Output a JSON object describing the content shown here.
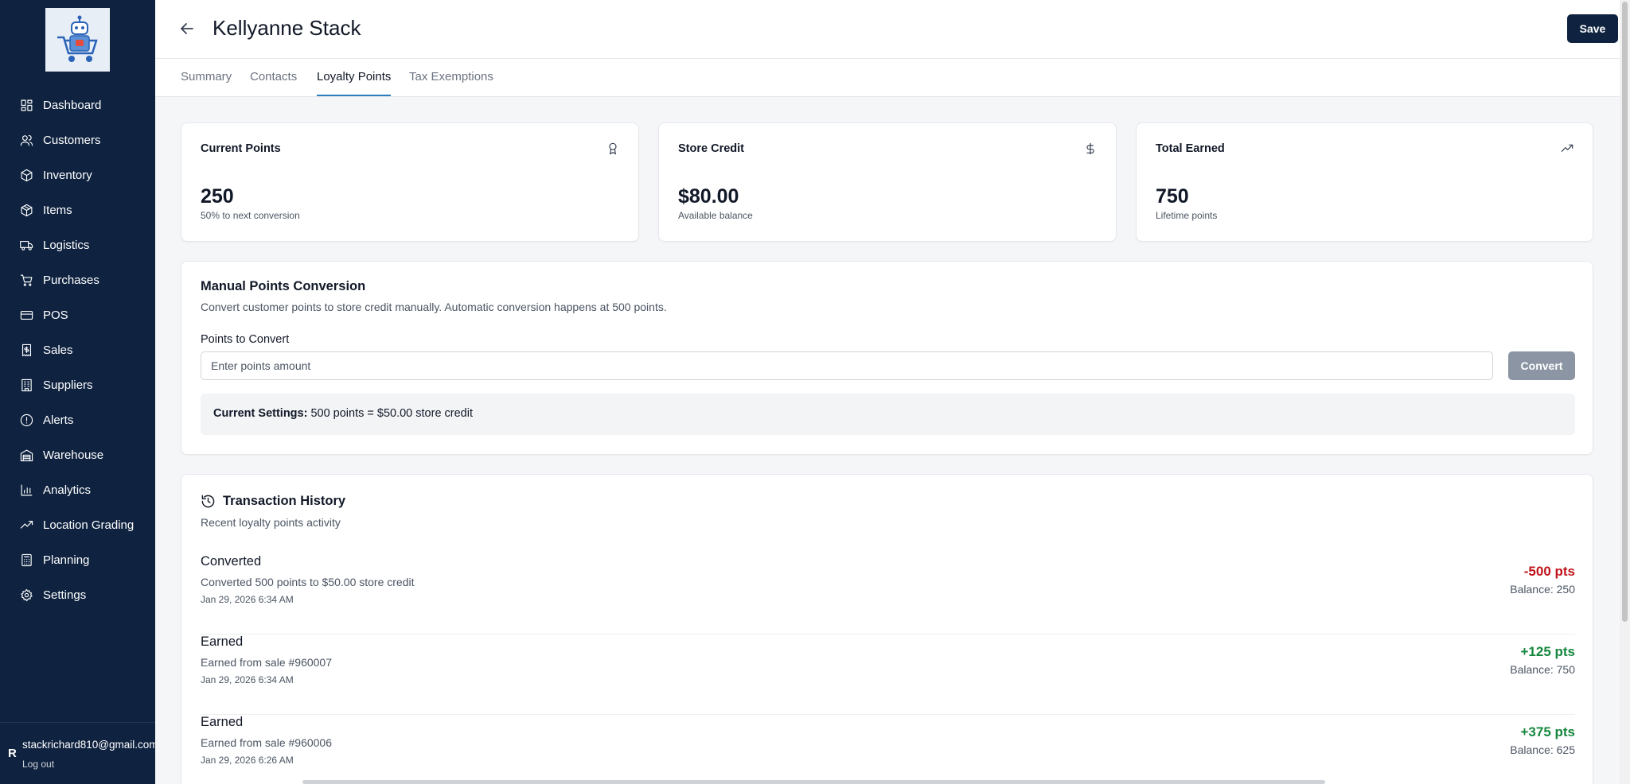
{
  "sidebar": {
    "items": [
      {
        "label": "Dashboard",
        "icon": "dashboard-icon"
      },
      {
        "label": "Customers",
        "icon": "users-icon"
      },
      {
        "label": "Inventory",
        "icon": "package-icon"
      },
      {
        "label": "Items",
        "icon": "box-icon"
      },
      {
        "label": "Logistics",
        "icon": "truck-icon"
      },
      {
        "label": "Purchases",
        "icon": "cart-icon"
      },
      {
        "label": "POS",
        "icon": "credit-card-icon"
      },
      {
        "label": "Sales",
        "icon": "receipt-icon"
      },
      {
        "label": "Suppliers",
        "icon": "building-icon"
      },
      {
        "label": "Alerts",
        "icon": "alert-circle-icon"
      },
      {
        "label": "Warehouse",
        "icon": "warehouse-icon"
      },
      {
        "label": "Analytics",
        "icon": "bar-chart-icon"
      },
      {
        "label": "Location Grading",
        "icon": "trending-up-icon"
      },
      {
        "label": "Planning",
        "icon": "calculator-icon"
      },
      {
        "label": "Settings",
        "icon": "gear-icon"
      }
    ],
    "user_initial": "R",
    "user_email": "stackrichard810@gmail.com",
    "logout_label": "Log out"
  },
  "header": {
    "title": "Kellyanne Stack",
    "save_label": "Save"
  },
  "tabs": [
    {
      "label": "Summary",
      "active": false
    },
    {
      "label": "Contacts",
      "active": false
    },
    {
      "label": "Loyalty Points",
      "active": true
    },
    {
      "label": "Tax Exemptions",
      "active": false
    }
  ],
  "stats": [
    {
      "label": "Current Points",
      "value": "250",
      "sub": "50% to next conversion",
      "icon": "award-icon"
    },
    {
      "label": "Store Credit",
      "value": "$80.00",
      "sub": "Available balance",
      "icon": "dollar-icon"
    },
    {
      "label": "Total Earned",
      "value": "750",
      "sub": "Lifetime points",
      "icon": "trending-up-icon"
    }
  ],
  "conversion": {
    "title": "Manual Points Conversion",
    "description": "Convert customer points to store credit manually. Automatic conversion happens at 500 points.",
    "field_label": "Points to Convert",
    "placeholder": "Enter points amount",
    "value": "",
    "button_label": "Convert",
    "settings_label": "Current Settings:",
    "settings_value": "500 points = $50.00 store credit"
  },
  "history": {
    "title": "Transaction History",
    "description": "Recent loyalty points activity",
    "rows": [
      {
        "type": "Converted",
        "description": "Converted 500 points to $50.00 store credit",
        "date": "Jan 29, 2026 6:34 AM",
        "amount": "-500 pts",
        "balance": "Balance: 250",
        "sign": "negative"
      },
      {
        "type": "Earned",
        "description": "Earned from sale #960007",
        "date": "Jan 29, 2026 6:34 AM",
        "amount": "+125 pts",
        "balance": "Balance: 750",
        "sign": "positive"
      },
      {
        "type": "Earned",
        "description": "Earned from sale #960006",
        "date": "Jan 29, 2026 6:26 AM",
        "amount": "+375 pts",
        "balance": "Balance: 625",
        "sign": "positive"
      }
    ]
  },
  "colors": {
    "sidebar_bg": "#0f2340",
    "accent": "#2b7fbe",
    "negative": "#c0141b",
    "positive": "#15873d"
  }
}
